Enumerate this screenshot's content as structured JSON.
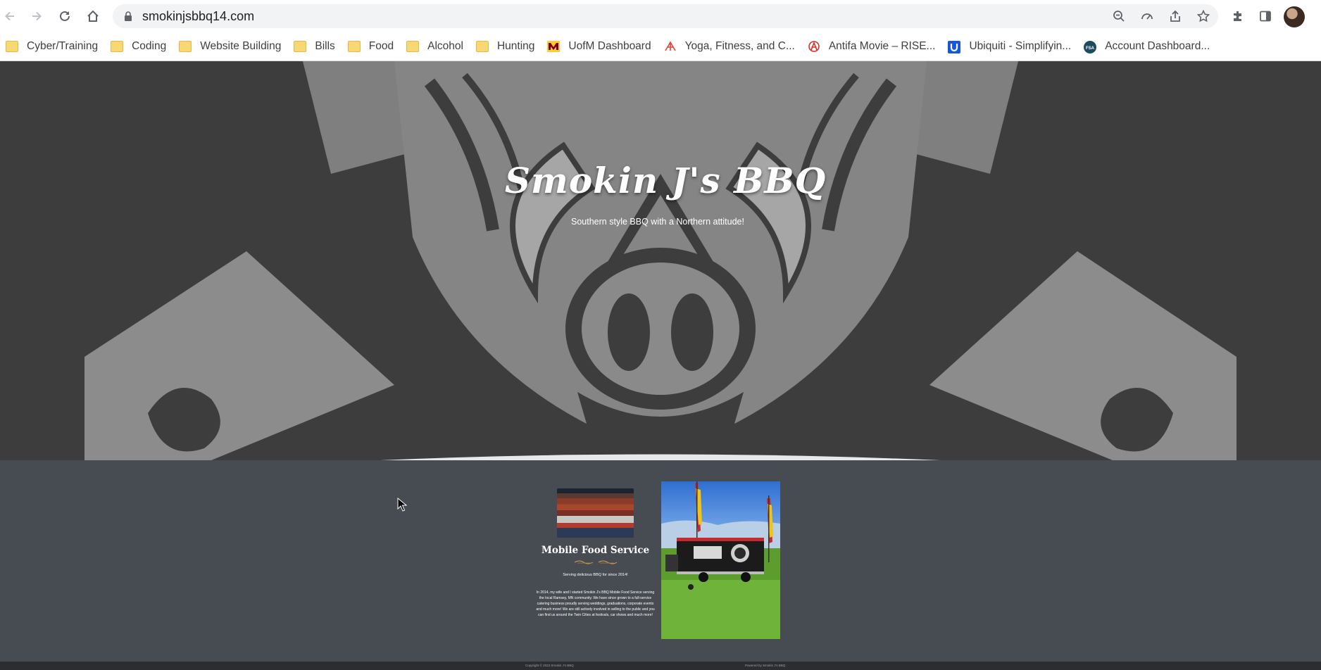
{
  "browser": {
    "url": "smokinjsbbq14.com",
    "bookmarks": [
      {
        "label": "Cyber/Training",
        "icon": "folder-icon"
      },
      {
        "label": "Coding",
        "icon": "folder-icon"
      },
      {
        "label": "Website Building",
        "icon": "folder-icon"
      },
      {
        "label": "Bills",
        "icon": "folder-icon"
      },
      {
        "label": "Food",
        "icon": "folder-icon"
      },
      {
        "label": "Alcohol",
        "icon": "folder-icon"
      },
      {
        "label": "Hunting",
        "icon": "folder-icon"
      },
      {
        "label": "UofM Dashboard",
        "icon": "umn-logo-icon"
      },
      {
        "label": "Yoga, Fitness, and C...",
        "icon": "yoga-site-icon"
      },
      {
        "label": "Antifa Movie – RISE...",
        "icon": "anarchy-a-icon"
      },
      {
        "label": "Ubiquiti - Simplifyin...",
        "icon": "ubiquiti-icon"
      },
      {
        "label": "Account Dashboard...",
        "icon": "fsa-icon"
      }
    ]
  },
  "hero": {
    "title": "Smokin J's BBQ",
    "tagline": "Southern style BBQ with a Northern attitude!"
  },
  "card": {
    "title": "Mobile Food Service",
    "subtitle": "Serving delicious BBQ for since 2014!",
    "body": "In 2014, my wife and I started Smokin J's BBQ Mobile Food Service serving the local Ramsey, MN community. We have since grown to a full-service catering business proudly serving weddings, graduations, corporate events and much more! We are still actively involved in selling to the public and you can find us around the Twin Cities at festivals, car shows and much more!"
  },
  "footer": {
    "copyright": "Copyright © 2023 Smokin J's BBQ",
    "powered": "Powered by Smokin J's BBQ"
  },
  "colors": {
    "hero_bg": "#3f3f3f",
    "content_bg": "#474b52",
    "footer_bg": "#2b2d31"
  }
}
